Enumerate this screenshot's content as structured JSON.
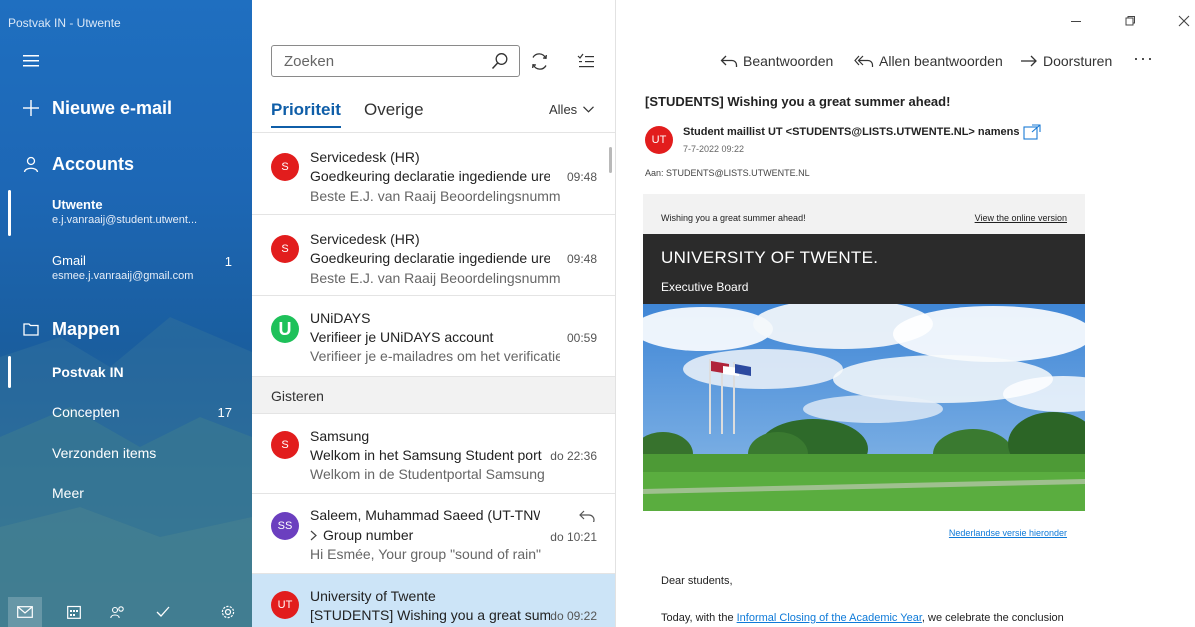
{
  "app": {
    "window_title": "Postvak IN - Utwente"
  },
  "sidebar": {
    "new_mail": "Nieuwe e-mail",
    "accounts_label": "Accounts",
    "accounts": [
      {
        "name": "Utwente",
        "email": "e.j.vanraaij@student.utwent...",
        "count": ""
      },
      {
        "name": "Gmail",
        "email": "esmee.j.vanraaij@gmail.com",
        "count": "1"
      }
    ],
    "folders_label": "Mappen",
    "folders": [
      {
        "label": "Postvak IN",
        "count": ""
      },
      {
        "label": "Concepten",
        "count": "17"
      },
      {
        "label": "Verzonden items",
        "count": ""
      },
      {
        "label": "Meer",
        "count": ""
      }
    ]
  },
  "list": {
    "search_placeholder": "Zoeken",
    "tab_priority": "Prioriteit",
    "tab_other": "Overige",
    "filter": "Alles",
    "group_yesterday": "Gisteren",
    "messages": [
      {
        "initials": "S",
        "color": "#e21d1d",
        "sender": "Servicedesk (HR)",
        "subject": "Goedkeuring declaratie ingediende uren",
        "time": "09:48",
        "preview": "Beste E.J. van Raaij Beoordelingsnummer"
      },
      {
        "initials": "S",
        "color": "#e21d1d",
        "sender": "Servicedesk (HR)",
        "subject": "Goedkeuring declaratie ingediende uren",
        "time": "09:48",
        "preview": "Beste E.J. van Raaij Beoordelingsnummer"
      },
      {
        "initials": "U",
        "color": "#1ec15a",
        "sender": "UNiDAYS",
        "subject": "Verifieer je UNiDAYS account",
        "time": "00:59",
        "preview": "Verifieer je e-mailadres om het verificatie"
      },
      {
        "initials": "S",
        "color": "#e21d1d",
        "sender": "Samsung",
        "subject": "Welkom in het Samsung Student port",
        "time": "do 22:36",
        "preview": "Welkom in de Studentportal Samsung"
      },
      {
        "initials": "SS",
        "color": "#6b3fbf",
        "sender": "Saleem, Muhammad Saeed (UT-TNW)",
        "subject": "Group number",
        "time": "do 10:21",
        "preview": "Hi Esmée, Your group \"sound of rain\""
      },
      {
        "initials": "UT",
        "color": "#e21d1d",
        "sender": "University of Twente",
        "subject": "[STUDENTS] Wishing you a great sum",
        "time": "do 09:22",
        "preview": ""
      }
    ]
  },
  "reading": {
    "reply": "Beantwoorden",
    "reply_all": "Allen beantwoorden",
    "forward": "Doorsturen",
    "subject": "[STUDENTS] Wishing you a great summer ahead!",
    "avatar": "UT",
    "from": "Student maillist UT <STUDENTS@LISTS.UTWENTE.NL> namens U",
    "date": "7-7-2022 09:22",
    "to": "Aan: STUDENTS@LISTS.UTWENTE.NL",
    "email": {
      "preheader": "Wishing you a great summer ahead!",
      "online_version": "View the online version",
      "university": "UNIVERSITY OF TWENTE.",
      "board": "Executive Board",
      "dutch_link": "Nederlandse versie hieronder",
      "greeting": "Dear students,",
      "body_prefix": "Today, with the ",
      "body_link": "Informal Closing of the Academic Year",
      "body_suffix": ", we celebrate the conclusion"
    }
  },
  "colors": {
    "accent": "#0f5ea8",
    "selected_row": "#cce4f7",
    "link": "#0e7ad8"
  }
}
